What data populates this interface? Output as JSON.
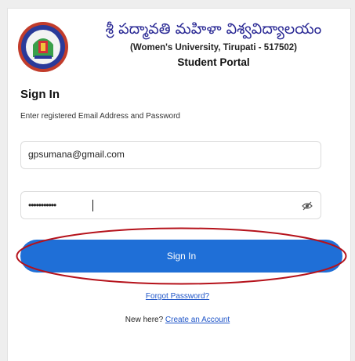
{
  "header": {
    "university_telugu": "శ్రీ పద్మావతి మహిళా విశ్వవిద్యాలయం",
    "university_english": "(Women's University, Tirupati - 517502)",
    "portal_title": "Student Portal"
  },
  "signin": {
    "title": "Sign In",
    "description": "Enter registered Email Address and Password",
    "email_value": "gpsumana@gmail.com",
    "password_mask": "•••••••••••",
    "button_label": "Sign In",
    "forgot_label": "Forgot Password?",
    "new_here_label": "New here?",
    "create_account_label": "Create an Account"
  },
  "icons": {
    "logo": "university-seal-icon",
    "password_toggle": "eye-slash-icon"
  },
  "colors": {
    "accent": "#1f6fd7",
    "highlight": "#b5121b",
    "header_text": "#2b2a95"
  }
}
